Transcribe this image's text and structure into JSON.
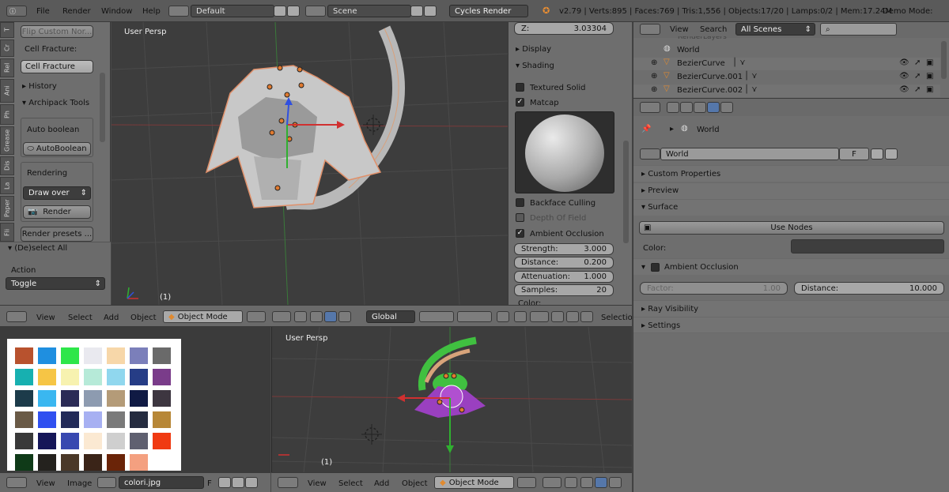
{
  "topbar": {
    "menus": [
      "File",
      "Render",
      "Window",
      "Help"
    ],
    "layout": "Default",
    "scene": "Scene",
    "engine": "Cycles Render",
    "stats": "v2.79 | Verts:895 | Faces:769 | Tris:1,556 | Objects:17/20 | Lamps:0/2 | Mem:17.24M",
    "demo": "Demo Mode:"
  },
  "toolshelf": {
    "tabs": [
      "T",
      "Cr",
      "Rel",
      "Ani",
      "Ph",
      "Grease",
      "Dis",
      "La",
      "Paper",
      "Fli"
    ],
    "flip": "Flip Custom Nor...",
    "cell_fracture_label": "Cell Fracture:",
    "cell_fracture_btn": "Cell Fracture",
    "history": "History",
    "archipack": "Archipack Tools",
    "auto_boolean_label": "Auto boolean",
    "auto_boolean_btn": "AutoBoolean",
    "rendering_label": "Rendering",
    "draw_over": "Draw over",
    "render_btn": "Render",
    "render_presets": "Render presets ...",
    "deselect": "(De)select All",
    "action_label": "Action",
    "action_value": "Toggle"
  },
  "viewport_top": {
    "label": "User Persp",
    "frame": "(1)"
  },
  "npanel": {
    "z_label": "Z:",
    "z_value": "3.03304",
    "display": "Display",
    "shading": "Shading",
    "textured_solid": "Textured Solid",
    "matcap": "Matcap",
    "backface": "Backface Culling",
    "dof": "Depth Of Field",
    "ao": "Ambient Occlusion",
    "strength_l": "Strength:",
    "strength_v": "3.000",
    "distance_l": "Distance:",
    "distance_v": "0.200",
    "atten_l": "Attenuation:",
    "atten_v": "1.000",
    "samples_l": "Samples:",
    "samples_v": "20",
    "color": "Color:"
  },
  "header3d": {
    "view": "View",
    "select": "Select",
    "add": "Add",
    "object": "Object",
    "mode": "Object Mode",
    "orient": "Global",
    "selection": "Selection"
  },
  "image_editor": {
    "view": "View",
    "image": "Image",
    "filename": "colori.jpg",
    "f": "F"
  },
  "palette": [
    "#b8522e",
    "#1f8fe0",
    "#2ee64a",
    "#e9e9ef",
    "#f7d7a9",
    "#7b7fba",
    "#6a6a6a",
    "#17b0b0",
    "#f6c545",
    "#f7f2b0",
    "#b6ead8",
    "#90d7ee",
    "#263d86",
    "#7a3c8a",
    "#1c3b4a",
    "#3ab7f0",
    "#2b2b56",
    "#8d9bb0",
    "#b49b78",
    "#101a44",
    "#3d3640",
    "#6a5a46",
    "#3050f0",
    "#222a58",
    "#a7b0f2",
    "#7a7a7a",
    "#252c40",
    "#b78737",
    "#393939",
    "#151658",
    "#3848b0",
    "#fbe9d2",
    "#cfcfcf",
    "#5f6070",
    "#f03a12",
    "#0f3a18",
    "#24221e",
    "#4a3828",
    "#3a2418",
    "#6a2408",
    "#f4a080"
  ],
  "viewport_bottom": {
    "label": "User Persp",
    "frame": "(1)"
  },
  "header3d_b": {
    "view": "View",
    "select": "Select",
    "add": "Add",
    "object": "Object",
    "mode": "Object Mode"
  },
  "outliner": {
    "view": "View",
    "search": "Search",
    "filter": "All Scenes",
    "partial": "RenderLayers",
    "items": [
      "World",
      "BezierCurve",
      "BezierCurve.001",
      "BezierCurve.002"
    ]
  },
  "properties": {
    "breadcrumb": "World",
    "world_name": "World",
    "f": "F",
    "sections": [
      "Custom Properties",
      "Preview",
      "Surface"
    ],
    "use_nodes": "Use Nodes",
    "color_label": "Color:",
    "ao": "Ambient Occlusion",
    "factor_l": "Factor:",
    "factor_v": "1.00",
    "distance_l": "Distance:",
    "distance_v": "10.000",
    "ray": "Ray Visibility",
    "settings": "Settings"
  }
}
